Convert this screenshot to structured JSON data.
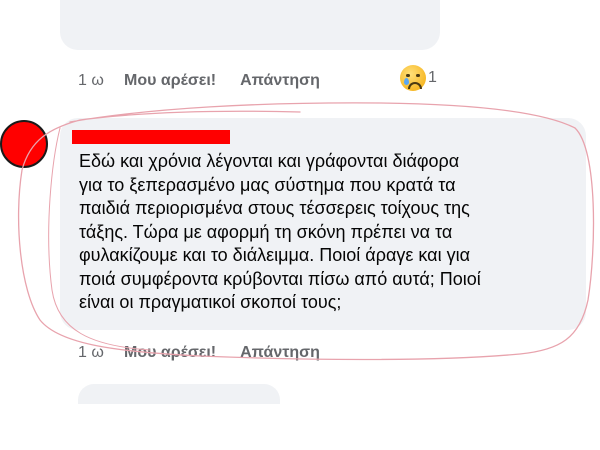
{
  "previous_comment": {
    "time": "1 ω",
    "like_label": "Μου αρέσει!",
    "reply_label": "Απάντηση",
    "reaction": {
      "icon": "sad-crying-face-icon",
      "count": "1"
    }
  },
  "comment": {
    "lines": [
      "Εδώ και χρόνια λέγονται και γράφονται διάφορα",
      "για το ξεπερασμένο μας σύστημα που κρατά τα",
      "παιδιά περιορισμένα στους τέσσερεις τοίχους της",
      "τάξης. Τώρα με αφορμή τη σκόνη πρέπει να τα",
      "φυλακίζουμε και το διάλειμμα. Ποιοί άραγε και για",
      "ποιά συμφέροντα κρύβονται πίσω από αυτά; Ποιοί",
      "είναι οι πραγματικοί σκοποί τους;"
    ],
    "time": "1 ω",
    "like_label": "Μου αρέσει!",
    "reply_label": "Απάντηση"
  },
  "colors": {
    "bubble": "#f0f2f5",
    "meta_text": "#65676b",
    "redaction": "#ff0000",
    "annotation_circle": "#e8a3ad"
  }
}
